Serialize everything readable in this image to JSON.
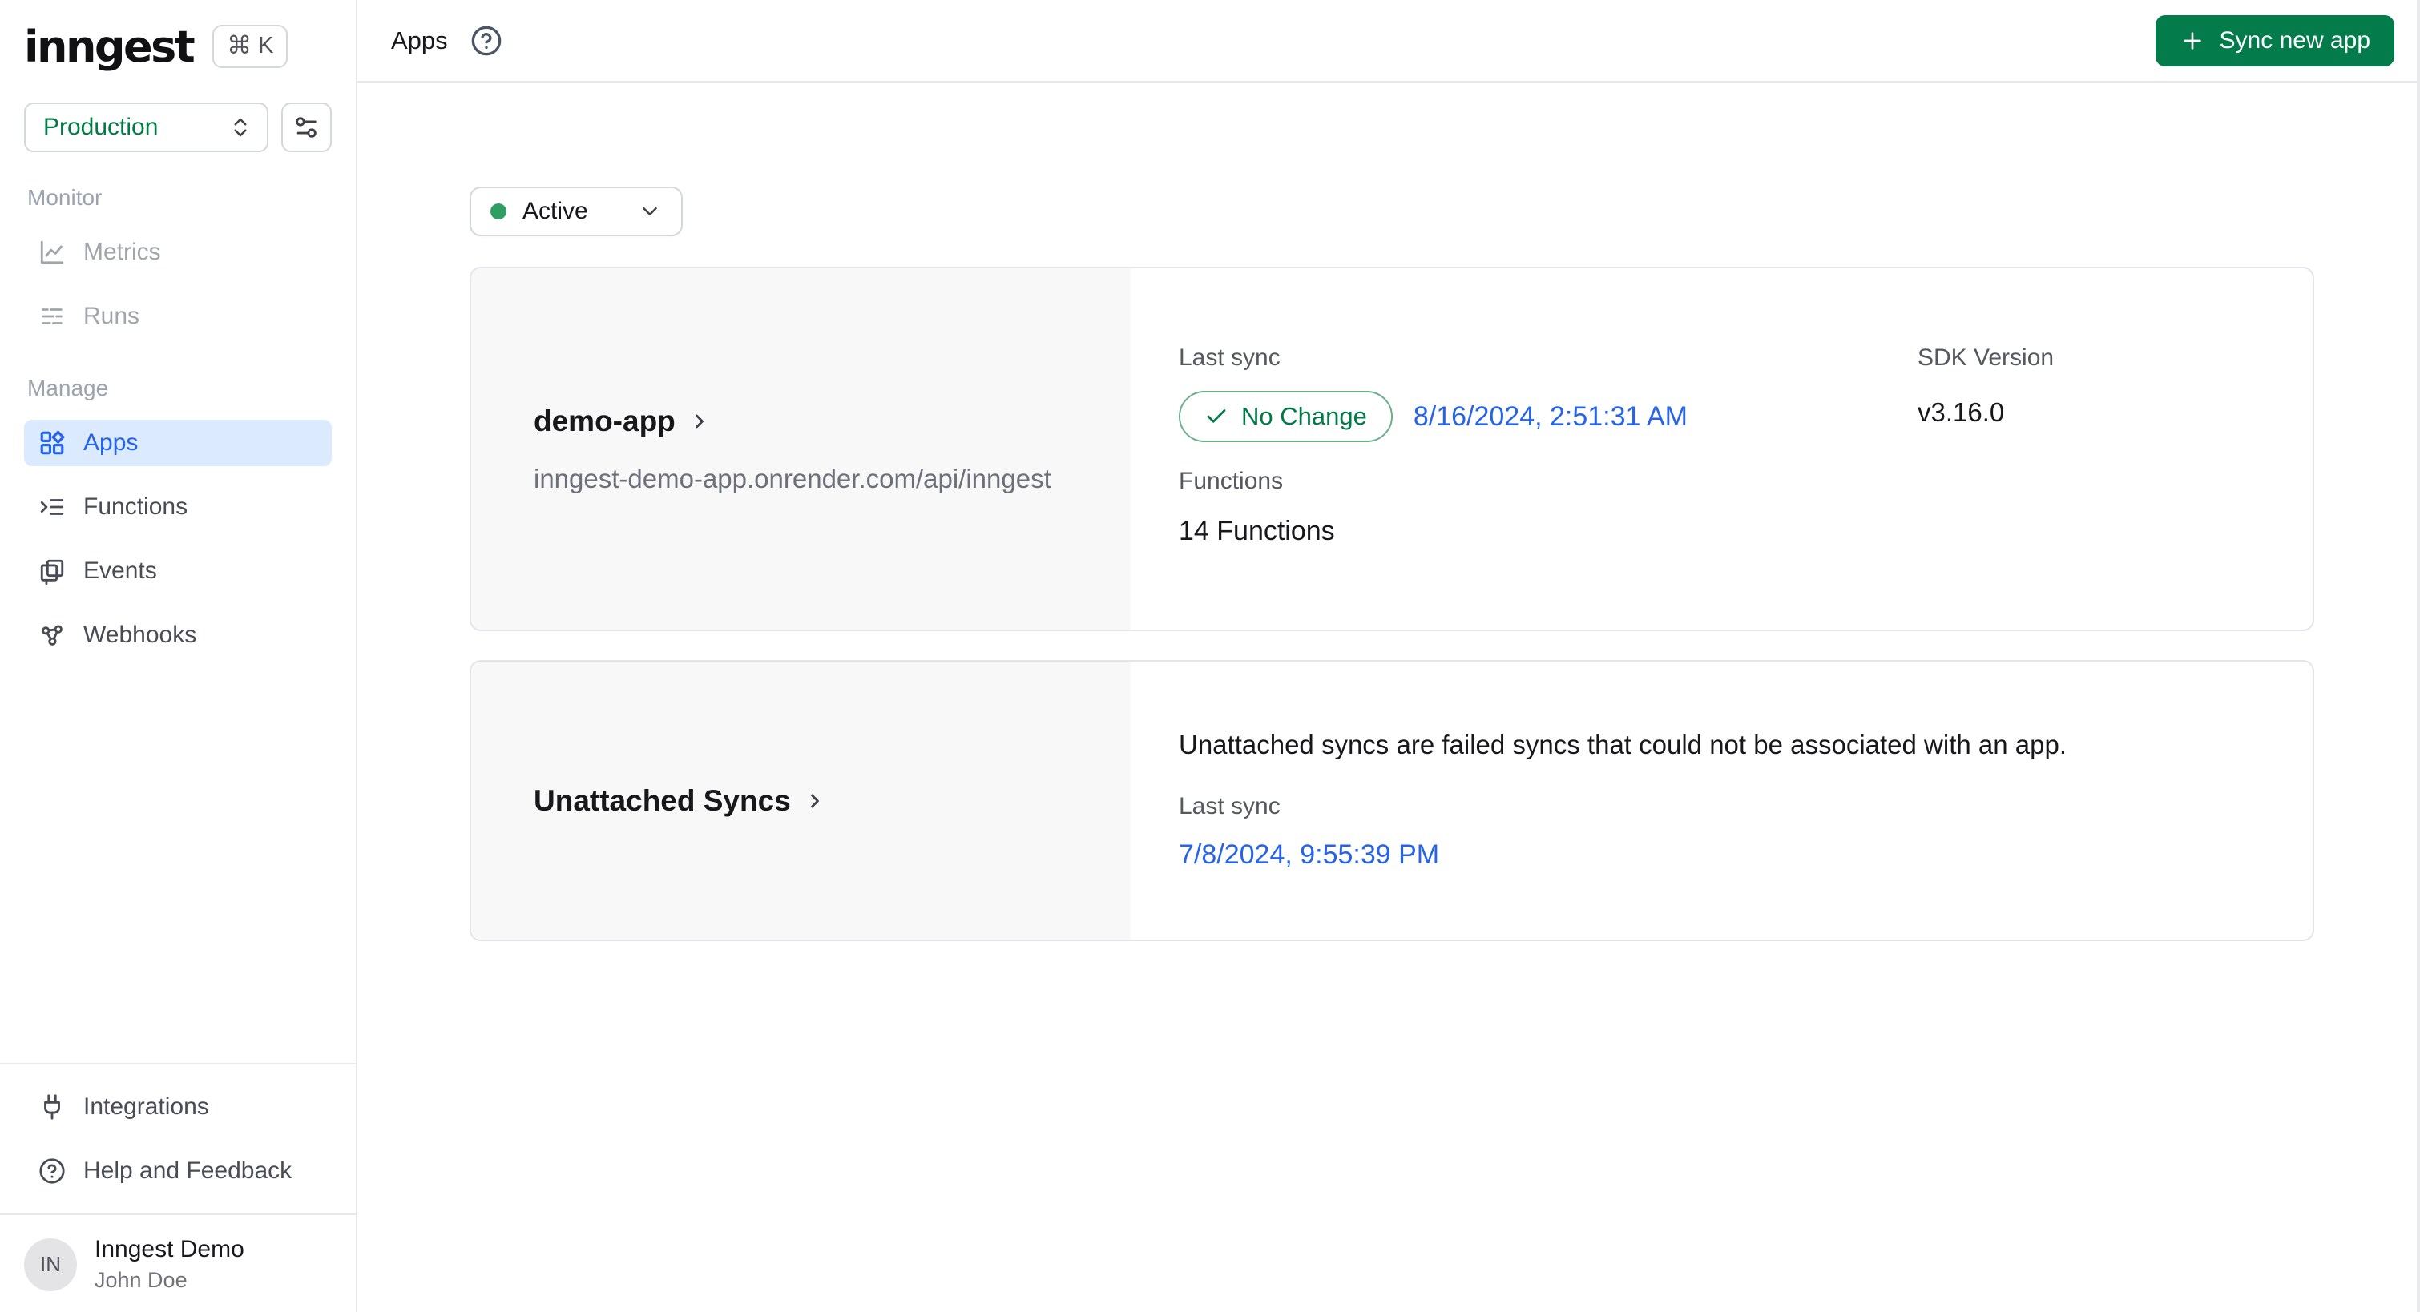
{
  "app": {
    "logo_text": "inngest",
    "shortcut_key": "K",
    "shortcut_cmd": "⌘"
  },
  "colors": {
    "accent-green": "#037b4b",
    "green-text": "#027a48",
    "active-dot": "#2f9e63",
    "badge-border": "#6caf8d",
    "link-blue": "#2563eb",
    "active-item-bg": "#dbeafe",
    "active-item-text": "#2563eb"
  },
  "sidebar": {
    "env_selector": {
      "value": "Production"
    },
    "sections": [
      {
        "label": "Monitor",
        "items": [
          {
            "label": "Metrics",
            "icon": "chart-icon"
          },
          {
            "label": "Runs",
            "icon": "runs-icon"
          }
        ]
      },
      {
        "label": "Manage",
        "items": [
          {
            "label": "Apps",
            "icon": "apps-grid-icon"
          },
          {
            "label": "Functions",
            "icon": "functions-icon"
          },
          {
            "label": "Events",
            "icon": "events-icon"
          },
          {
            "label": "Webhooks",
            "icon": "webhook-icon"
          }
        ]
      }
    ],
    "footer_items": [
      {
        "label": "Integrations",
        "icon": "plug-icon"
      },
      {
        "label": "Help and Feedback",
        "icon": "help-circle-icon"
      }
    ],
    "profile": {
      "initials": "IN",
      "org": "Inngest Demo",
      "user": "John Doe"
    }
  },
  "topbar": {
    "title": "Apps",
    "action_label": "Sync new app"
  },
  "main": {
    "filter": {
      "value": "Active"
    },
    "cards": [
      {
        "name": "demo-app",
        "url": "inngest-demo-app.onrender.com/api/inngest",
        "last_sync_label": "Last sync",
        "sync_status": "No Change",
        "last_sync_time": "8/16/2024, 2:51:31 AM",
        "sdk_version_label": "SDK Version",
        "sdk_version": "v3.16.0",
        "functions_label": "Functions",
        "functions_count": "14 Functions"
      },
      {
        "name": "Unattached Syncs",
        "description": "Unattached syncs are failed syncs that could not be associated with an app.",
        "last_sync_label": "Last sync",
        "last_sync_time": "7/8/2024, 9:55:39 PM"
      }
    ]
  }
}
